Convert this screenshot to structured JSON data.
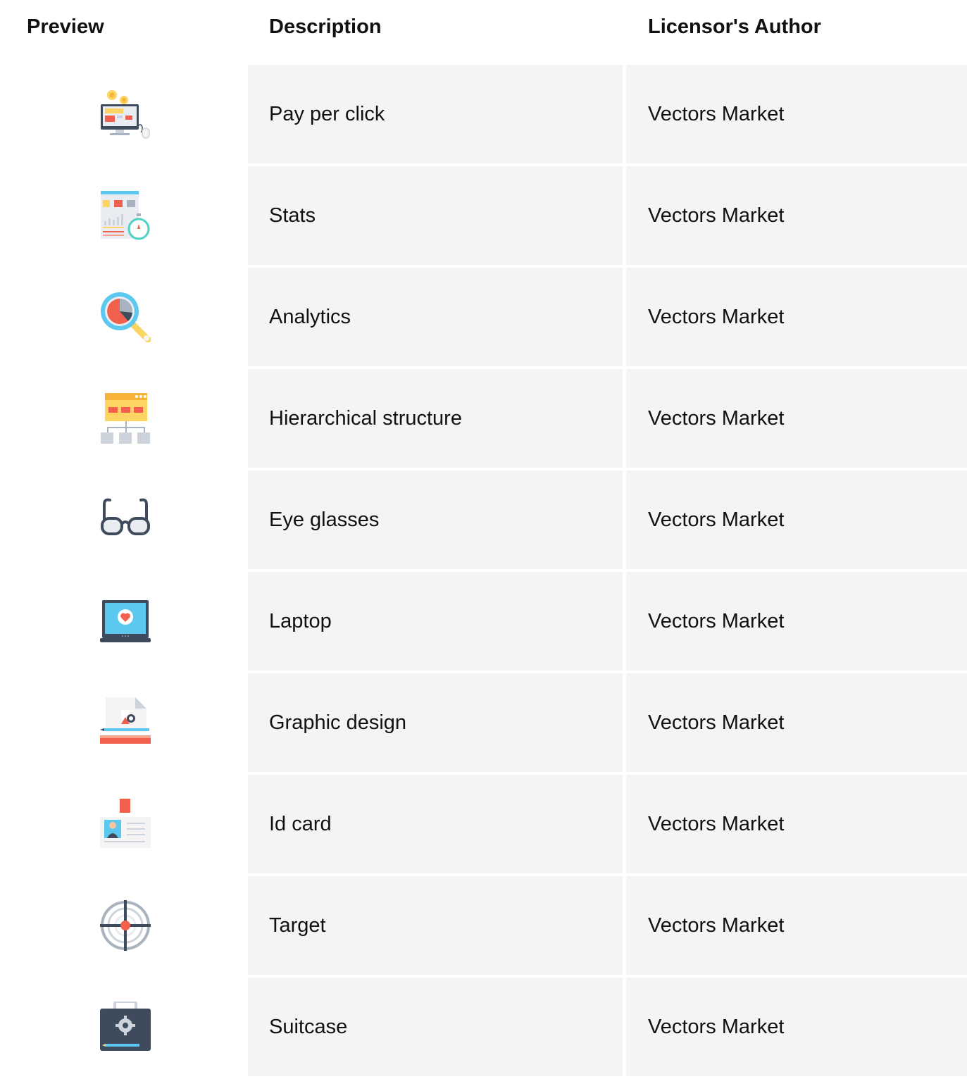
{
  "table": {
    "headers": {
      "preview": "Preview",
      "description": "Description",
      "author": "Licensor's Author"
    },
    "rows": [
      {
        "icon": "pay-per-click-icon",
        "description": "Pay per click",
        "author": "Vectors Market"
      },
      {
        "icon": "stats-icon",
        "description": "Stats",
        "author": "Vectors Market"
      },
      {
        "icon": "analytics-icon",
        "description": "Analytics",
        "author": "Vectors Market"
      },
      {
        "icon": "hierarchical-structure-icon",
        "description": "Hierarchical structure",
        "author": "Vectors Market"
      },
      {
        "icon": "eye-glasses-icon",
        "description": "Eye glasses",
        "author": "Vectors Market"
      },
      {
        "icon": "laptop-icon",
        "description": "Laptop",
        "author": "Vectors Market"
      },
      {
        "icon": "graphic-design-icon",
        "description": "Graphic design",
        "author": "Vectors Market"
      },
      {
        "icon": "id-card-icon",
        "description": "Id card",
        "author": "Vectors Market"
      },
      {
        "icon": "target-icon",
        "description": "Target",
        "author": "Vectors Market"
      },
      {
        "icon": "suitcase-icon",
        "description": "Suitcase",
        "author": "Vectors Market"
      }
    ]
  },
  "colors": {
    "cell_background": "#f4f4f4",
    "text": "#111111",
    "icon_dark": "#3d4b5c",
    "icon_blue": "#5cc8f0",
    "icon_red": "#f0604d",
    "icon_yellow": "#fcd462",
    "icon_gray": "#cdd3db",
    "icon_teal": "#4fd1c5"
  }
}
